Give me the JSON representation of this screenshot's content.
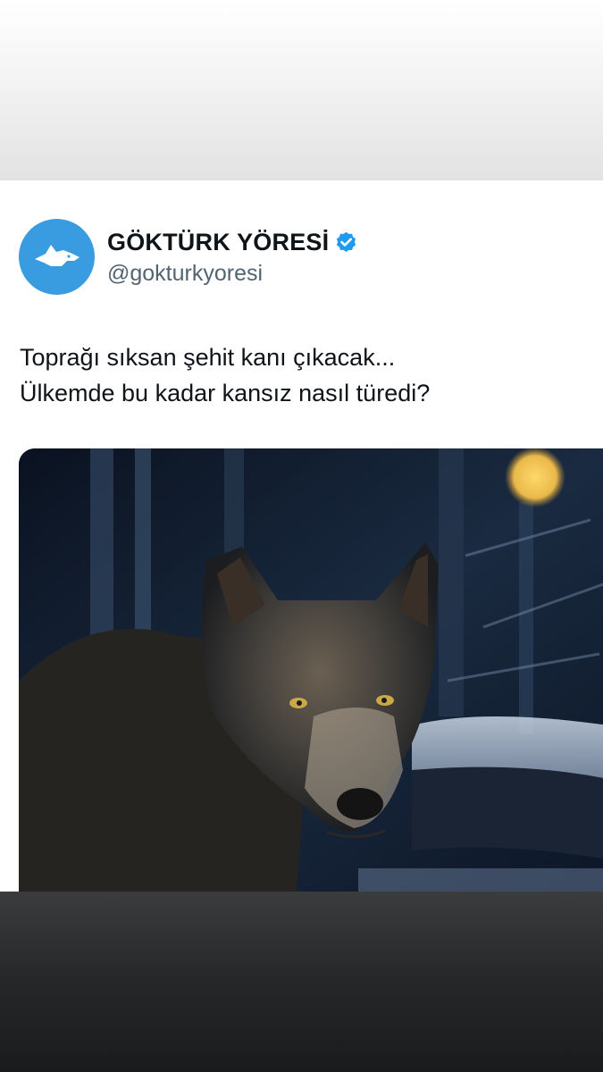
{
  "tweet": {
    "author": {
      "display_name": "GÖKTÜRK YÖRESİ",
      "handle": "@gokturkyoresi",
      "verified": true,
      "avatar_icon": "wolf-head-icon",
      "avatar_color": "#3a9ce0"
    },
    "text_lines": [
      "Toprağı sıksan şehit kanı çıkacak...",
      "Ülkemde bu kadar kansız nasıl türedi?"
    ],
    "media": {
      "type": "photo",
      "icon": "wolf-photo"
    }
  },
  "colors": {
    "verified_badge": "#1d9bf0",
    "text_primary": "#0f1419",
    "text_secondary": "#536471"
  }
}
